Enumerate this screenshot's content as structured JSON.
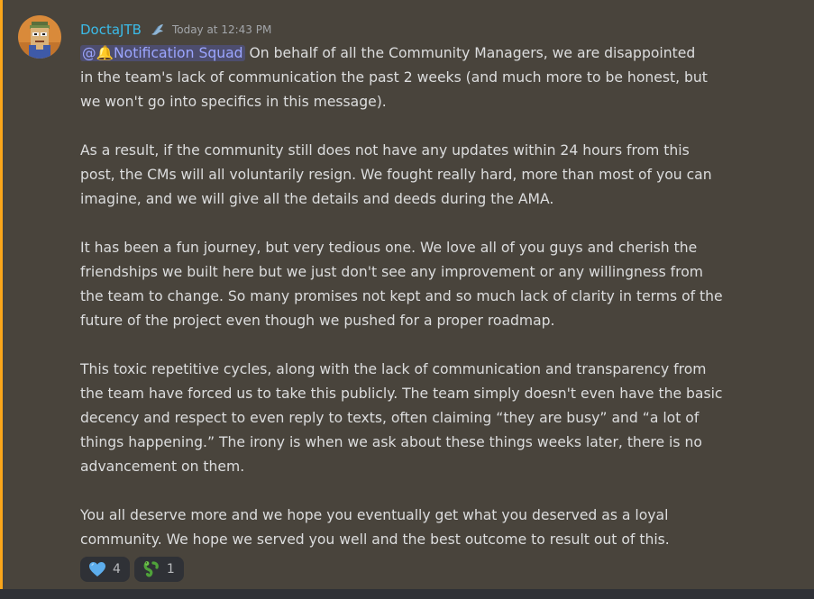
{
  "message": {
    "author": "DoctaJTB",
    "author_badge": "blue-bird-icon",
    "timestamp": "Today at 12:43 PM",
    "mention": "@🔔Notification Squad",
    "first_line_tail": " On behalf of all the Community Managers, we are disappointed",
    "paragraph_1_rest": "in the team's lack of communication the past 2 weeks (and much more to be honest, but\nwe won't go into specifics in this message).",
    "paragraph_2": "As a result, if the community still does not have any updates within 24 hours from this\npost, the CMs will all voluntarily resign. We fought really hard, more than most of you can\nimagine, and we will give all the details and deeds during the AMA.",
    "paragraph_3": "It has been a fun journey, but very tedious one. We love all of you guys and cherish the\nfriendships we built here but we just don't see any improvement or any willingness from\nthe team to change. So many promises not kept and so much lack of clarity in terms of the\nfuture of the project even though we pushed for a proper roadmap.",
    "paragraph_4": "This toxic repetitive cycles, along with the lack of communication and transparency from\nthe team have forced us to take this publicly. The team simply doesn't even have the basic\ndecency and respect to even reply to texts, often claiming “they are busy” and “a lot of\nthings happening.” The irony is when we ask about these things weeks later, there is no\nadvancement on them.",
    "paragraph_5": "You all deserve more and we hope you eventually get what you deserved as a loyal\ncommunity. We hope we served you well and the best outcome to result out of this."
  },
  "reactions": [
    {
      "icon": "blue-heart-icon",
      "count": "4"
    },
    {
      "icon": "green-snake-icon",
      "count": "1"
    }
  ],
  "colors": {
    "background": "#49443c",
    "mention_bar": "#faa61a",
    "username": "#3bbbe8",
    "text": "#dcddde",
    "mention_text": "#9ba5ff"
  }
}
